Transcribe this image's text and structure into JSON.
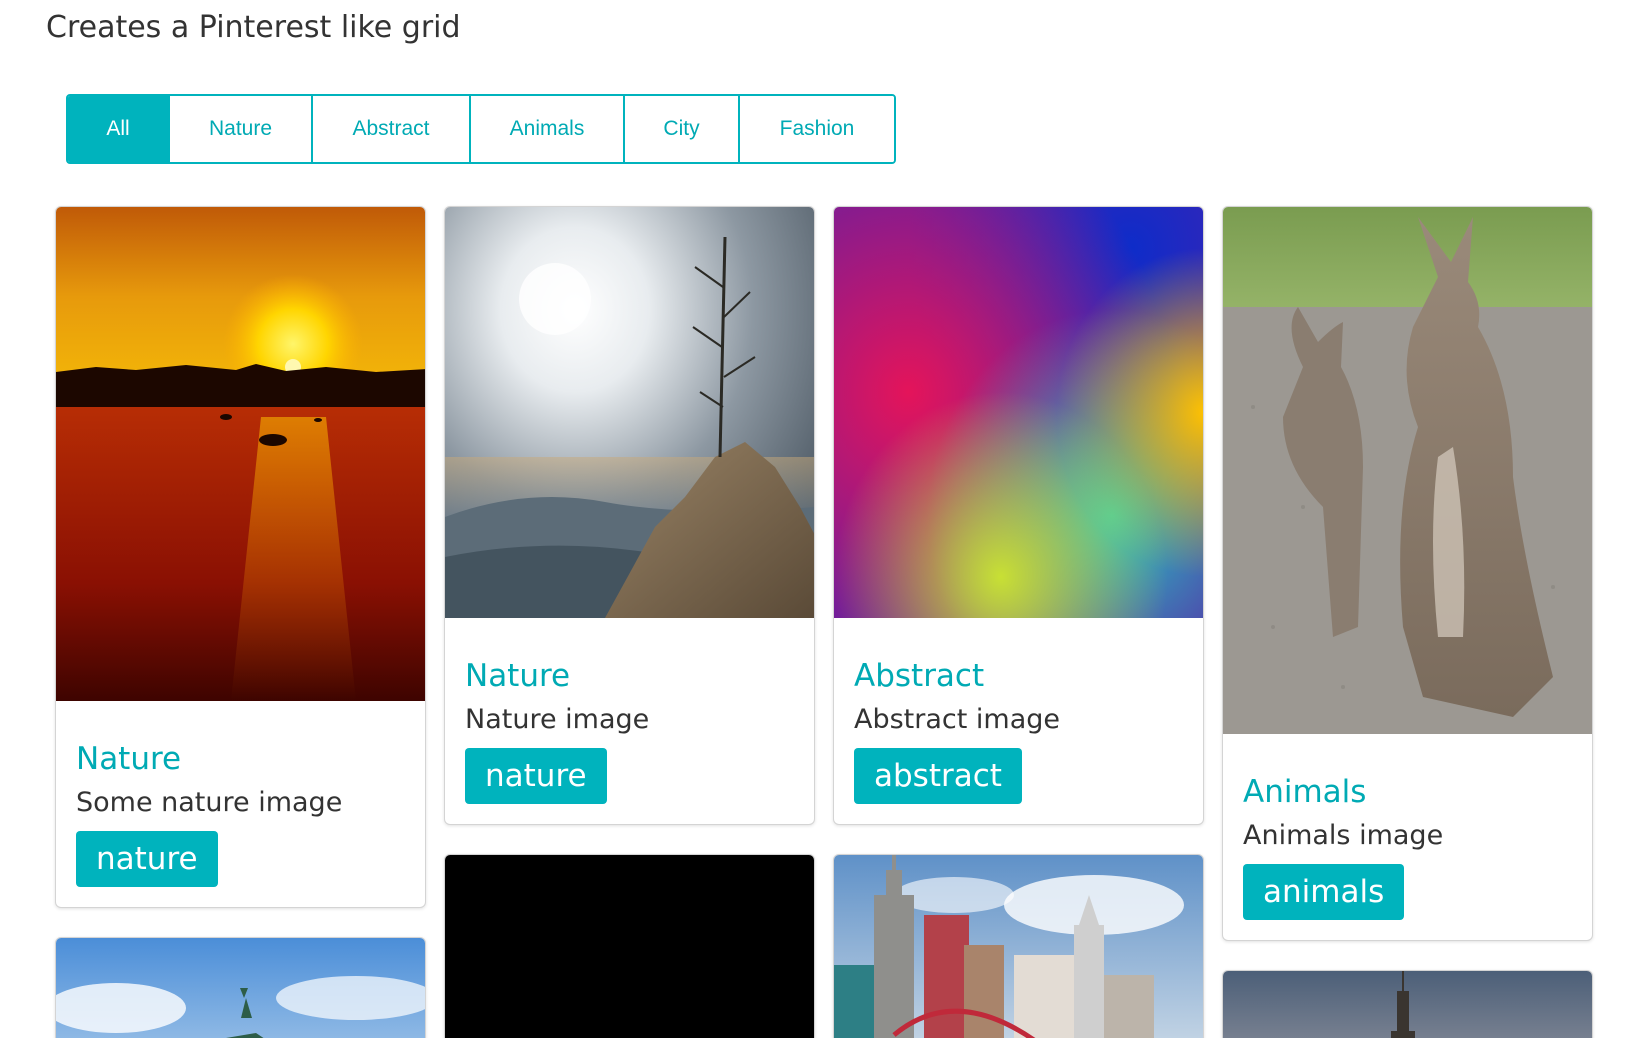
{
  "page": {
    "title": "Creates a Pinterest like grid"
  },
  "filters": [
    {
      "label": "All",
      "active": true
    },
    {
      "label": "Nature",
      "active": false
    },
    {
      "label": "Abstract",
      "active": false
    },
    {
      "label": "Animals",
      "active": false
    },
    {
      "label": "City",
      "active": false
    },
    {
      "label": "Fashion",
      "active": false
    }
  ],
  "cards": [
    {
      "title": "Nature",
      "description": "Some nature image",
      "tag": "nature",
      "image": "sunset-over-water"
    },
    {
      "title": "Nature",
      "description": "Nature image",
      "tag": "nature",
      "image": "tree-on-rock-under-sun"
    },
    {
      "title": "Abstract",
      "description": "Abstract image",
      "tag": "abstract",
      "image": "colorful-blur"
    },
    {
      "title": "Animals",
      "description": "Animals image",
      "tag": "animals",
      "image": "kangaroos"
    },
    {
      "image": "statue-blue-sky"
    },
    {
      "image": "black-image"
    },
    {
      "image": "city-skyline"
    },
    {
      "image": "tower-at-dusk"
    }
  ],
  "colors": {
    "accent": "#00b3bd",
    "accent_text": "#00aab4"
  }
}
